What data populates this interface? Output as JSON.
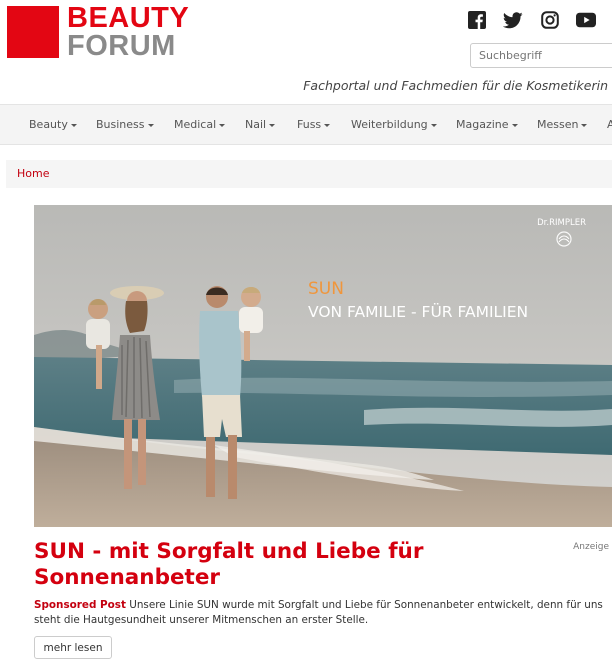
{
  "brand": {
    "line1": "BEAUTY",
    "line2": "FORUM",
    "color_primary": "#e30613",
    "color_secondary": "#8a8a8a"
  },
  "social": [
    {
      "icon": "facebook-icon"
    },
    {
      "icon": "twitter-icon"
    },
    {
      "icon": "instagram-icon"
    },
    {
      "icon": "youtube-icon"
    }
  ],
  "search": {
    "placeholder": "Suchbegriff"
  },
  "tagline": "Fachportal und Fachmedien für die Kosmetikerin",
  "nav": {
    "items": [
      {
        "label": "Beauty"
      },
      {
        "label": "Business"
      },
      {
        "label": "Medical"
      },
      {
        "label": "Nail"
      },
      {
        "label": "Fuss"
      },
      {
        "label": "Weiterbildung"
      },
      {
        "label": "Magazine"
      },
      {
        "label": "Messen"
      },
      {
        "label": "A"
      }
    ]
  },
  "breadcrumb": {
    "home": "Home"
  },
  "hero": {
    "brand_mark": "Dr.RIMPLER",
    "title": "SUN",
    "subtitle": "VON FAMILIE - FÜR FAMILIEN"
  },
  "article": {
    "ad_label": "Anzeige",
    "headline": "SUN - mit Sorgfalt und Liebe für Sonnenanbeter",
    "sponsored_label": "Sponsored Post",
    "teaser": "Unsere Linie SUN wurde mit Sorgfalt und Liebe für Sonnenanbeter entwickelt, denn für uns steht die Hautgesundheit unserer Mitmenschen an erster Stelle.",
    "more_label": "mehr lesen"
  },
  "colors": {
    "accent_red": "#d4000f",
    "hero_title_orange": "#f0963c"
  }
}
